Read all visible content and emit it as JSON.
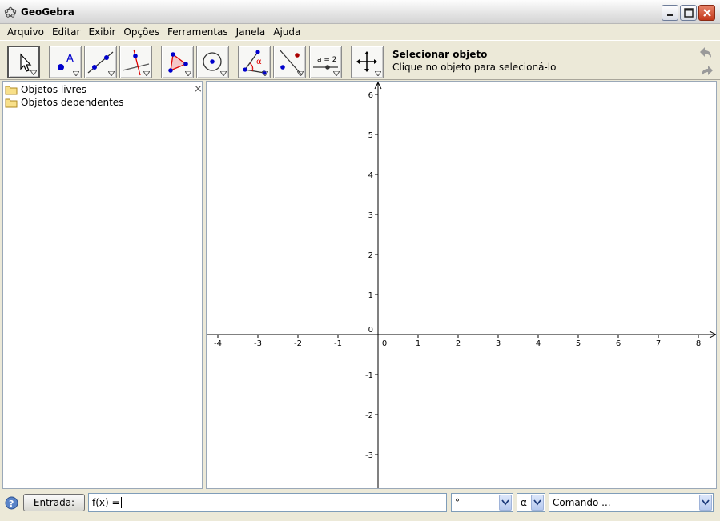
{
  "window": {
    "title": "GeoGebra"
  },
  "menu": [
    "Arquivo",
    "Editar",
    "Exibir",
    "Opções",
    "Ferramentas",
    "Janela",
    "Ajuda"
  ],
  "toolbar": {
    "tools": [
      {
        "name": "move-tool",
        "icon": "cursor-arrow-icon",
        "selected": true
      },
      {
        "name": "new-point-tool",
        "icon": "point-a-icon"
      },
      {
        "name": "line-tool",
        "icon": "line-through-points-icon"
      },
      {
        "name": "perpendicular-tool",
        "icon": "perpendicular-line-icon"
      },
      {
        "name": "polygon-tool",
        "icon": "polygon-icon"
      },
      {
        "name": "circle-tool",
        "icon": "circle-center-icon"
      },
      {
        "name": "angle-tool",
        "icon": "angle-icon"
      },
      {
        "name": "reflect-tool",
        "icon": "reflect-about-line-icon"
      },
      {
        "name": "slider-tool",
        "icon": "slider-icon",
        "label": "a = 2"
      },
      {
        "name": "move-view-tool",
        "icon": "move-graphics-view-icon"
      }
    ],
    "help_title": "Selecionar objeto",
    "help_desc": "Clique no objeto para selecioná-lo"
  },
  "algebra": {
    "items": [
      "Objetos livres",
      "Objetos dependentes"
    ],
    "close": "×"
  },
  "graphics": {
    "x_ticks": [
      -4,
      -3,
      -2,
      -1,
      0,
      1,
      2,
      3,
      4,
      5,
      6,
      7,
      8
    ],
    "y_ticks": [
      -3,
      -2,
      -1,
      1,
      2,
      3,
      4,
      5,
      6
    ],
    "origin_label": "0"
  },
  "inputbar": {
    "button": "Entrada:",
    "value": "f(x) =",
    "symbol_combo": "°",
    "greek_combo": "α",
    "command_combo": "Comando ..."
  },
  "colors": {
    "accent": "#0a246a",
    "close_button": "#c2381b",
    "point": "#0000cc"
  }
}
